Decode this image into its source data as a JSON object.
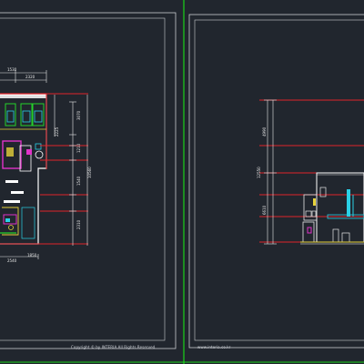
{
  "canvas": {
    "background": "#21262e",
    "sheet_border": "#c8cbd0",
    "separator": "#19d219"
  },
  "left_sheet": {
    "dims_top": [
      "1530",
      "2320"
    ],
    "dims_right": [
      "3070",
      "2225",
      "1210",
      "1540",
      "2310",
      "3510",
      "10560"
    ],
    "dims_bottom": [
      "2540",
      "1850"
    ],
    "footer": "Copyright © by INTERIA All Rights Reserved."
  },
  "right_sheet": {
    "dims_left": [
      "4990",
      "12550",
      "6610"
    ],
    "footer": "www.interia.co.kr"
  },
  "palette": {
    "red": "#e0242b",
    "magenta": "#e032c8",
    "yellow": "#e6d23a",
    "cyan": "#2ad0e6",
    "green": "#25d22a",
    "white": "#ffffff",
    "dim": "#e8e8e8"
  }
}
